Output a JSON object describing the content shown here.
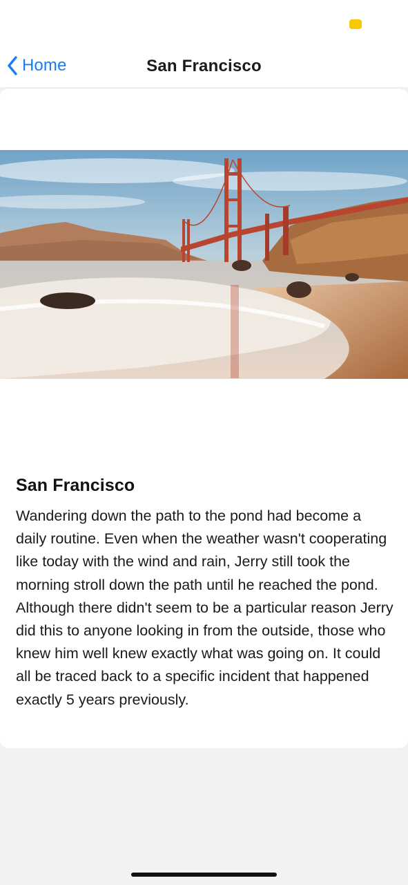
{
  "nav": {
    "back_label": "Home",
    "title": "San Francisco"
  },
  "article": {
    "image_alt": "Golden Gate Bridge over beach at sunset",
    "title": "San Francisco",
    "body": "Wandering down the path to the pond had become a daily routine. Even when the weather wasn't cooperating like today with the wind and rain, Jerry still took the morning stroll down the path until he reached the pond. Although there didn't seem to be a particular reason Jerry did this to anyone looking in from the outside, those who knew him well knew exactly what was going on. It could all be traced back to a specific incident that happened exactly 5 years previously."
  },
  "colors": {
    "accent": "#1a7cf0",
    "status_pill": "#f5c800",
    "background": "#f2f2f2",
    "card": "#ffffff"
  },
  "icons": {
    "back": "chevron-left-icon"
  }
}
